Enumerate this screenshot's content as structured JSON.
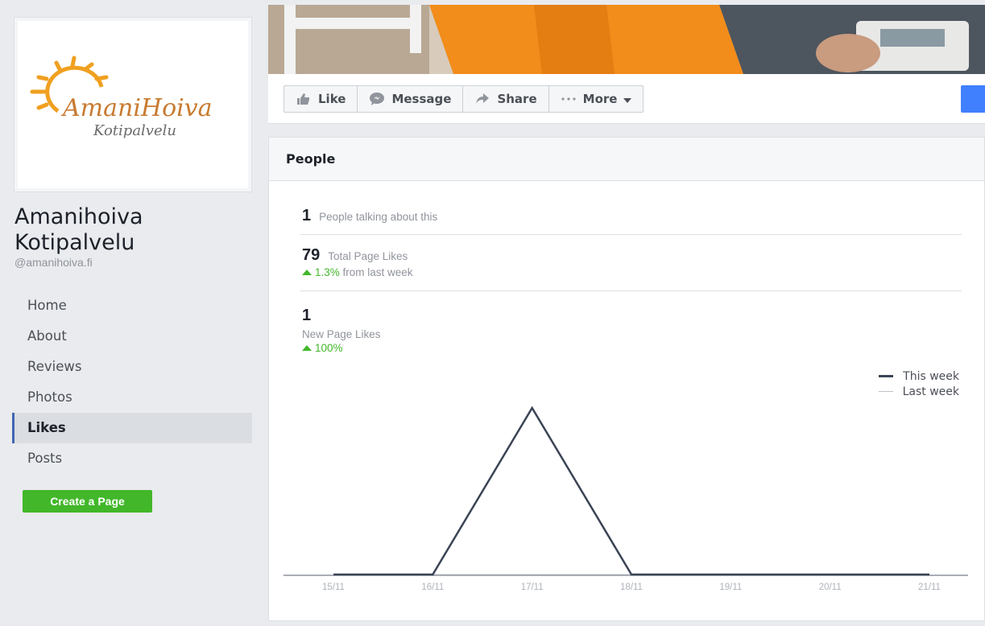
{
  "page": {
    "logo": {
      "brand": "AmaniHoiva",
      "tagline": "Kotipalvelu"
    },
    "name": "Amanihoiva Kotipalvelu",
    "name_line1": "Amanihoiva",
    "name_line2": "Kotipalvelu",
    "handle": "@amanihoiva.fi"
  },
  "nav": {
    "items": [
      {
        "label": "Home",
        "active": false
      },
      {
        "label": "About",
        "active": false
      },
      {
        "label": "Reviews",
        "active": false
      },
      {
        "label": "Photos",
        "active": false
      },
      {
        "label": "Likes",
        "active": true
      },
      {
        "label": "Posts",
        "active": false
      }
    ],
    "create_page": "Create a Page"
  },
  "actions": {
    "like": {
      "label": "Like",
      "icon": "thumbs-up-icon"
    },
    "message": {
      "label": "Message",
      "icon": "speech-bubble-icon"
    },
    "share": {
      "label": "Share",
      "icon": "share-arrow-icon"
    },
    "more": {
      "label": "More",
      "icon": "ellipsis-icon"
    }
  },
  "people": {
    "title": "People",
    "talking": {
      "count": "1",
      "label": "People talking about this"
    },
    "total_likes": {
      "count": "79",
      "label": "Total Page Likes",
      "change": "1.3%",
      "change_suffix": " from last week"
    },
    "new_likes": {
      "count": "1",
      "label": "New Page Likes",
      "change": "100%"
    }
  },
  "colors": {
    "accent_green": "#42b72a",
    "this_week_line": "#3b4455",
    "last_week_line": "#bec3c9",
    "brand_blue": "#4080ff"
  },
  "chart_data": {
    "type": "line",
    "x": [
      "15/11",
      "16/11",
      "17/11",
      "18/11",
      "19/11",
      "20/11",
      "21/11"
    ],
    "series": [
      {
        "name": "This week",
        "values": [
          0,
          0,
          1,
          0,
          0,
          0,
          0
        ]
      },
      {
        "name": "Last week",
        "values": [
          0,
          0,
          0,
          0,
          0,
          0,
          0
        ]
      }
    ],
    "ylim": [
      0,
      1
    ],
    "grid": false,
    "legend": "top-right"
  }
}
